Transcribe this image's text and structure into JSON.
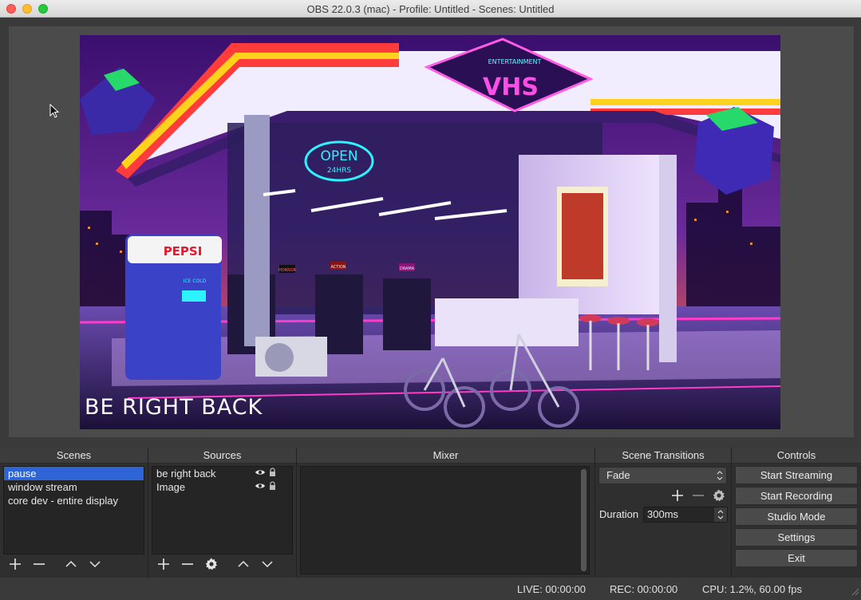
{
  "window": {
    "title": "OBS 22.0.3 (mac) - Profile: Untitled - Scenes: Untitled"
  },
  "preview": {
    "overlay_text": "BE RIGHT BACK",
    "sign_pepsi": "PEPSI",
    "sign_open": "OPEN",
    "sign_24hrs": "24HRS",
    "sign_vhs": "VHS",
    "sign_entertainment": "ENTERTAINMENT",
    "sign_ice_cold": "ICE COLD",
    "sign_horror": "HORROR",
    "sign_action": "ACTION",
    "sign_drama": "DRAMA"
  },
  "docks": {
    "scenes": {
      "header": "Scenes",
      "items": [
        "pause",
        "window stream",
        "core dev - entire display"
      ],
      "selected_index": 0
    },
    "sources": {
      "header": "Sources",
      "items": [
        "be right back",
        "Image"
      ]
    },
    "mixer": {
      "header": "Mixer"
    },
    "transitions": {
      "header": "Scene Transitions",
      "selected": "Fade",
      "duration_label": "Duration",
      "duration_value": "300ms"
    },
    "controls": {
      "header": "Controls",
      "start_streaming": "Start Streaming",
      "start_recording": "Start Recording",
      "studio_mode": "Studio Mode",
      "settings": "Settings",
      "exit": "Exit"
    }
  },
  "statusbar": {
    "live": "LIVE: 00:00:00",
    "rec": "REC: 00:00:00",
    "cpu": "CPU: 1.2%, 60.00 fps"
  },
  "colors": {
    "selection": "#2f64d6",
    "panel_bg": "#2f2f2f",
    "list_bg": "#252525",
    "button_bg": "#4a4a4a"
  },
  "icons": [
    "cursor-icon",
    "plus-icon",
    "minus-icon",
    "chevron-up-icon",
    "chevron-down-icon",
    "gear-icon",
    "eye-icon",
    "lock-icon",
    "resize-grip-icon"
  ]
}
